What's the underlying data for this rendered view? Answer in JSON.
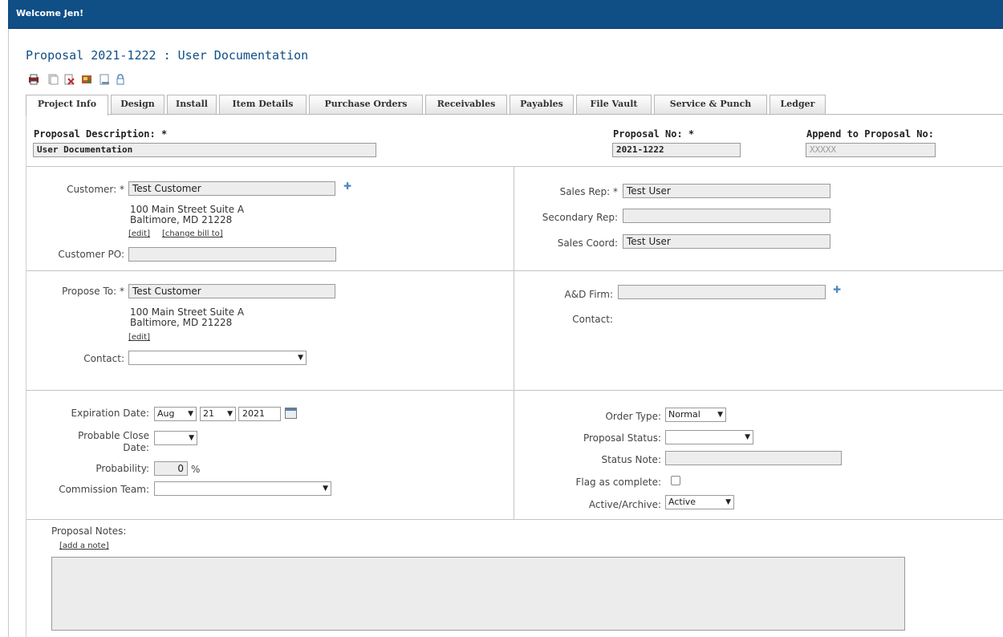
{
  "header": {
    "welcome": "Welcome Jen!"
  },
  "page": {
    "title": "Proposal 2021-1222 : User Documentation"
  },
  "toolbar": {
    "icons": [
      "print-icon",
      "copy-icon",
      "delete-icon",
      "tools-icon",
      "document-icon",
      "lock-icon"
    ]
  },
  "tabs": [
    {
      "label": "Project Info",
      "active": true
    },
    {
      "label": "Design"
    },
    {
      "label": "Install"
    },
    {
      "label": "Item Details"
    },
    {
      "label": "Purchase Orders"
    },
    {
      "label": "Receivables"
    },
    {
      "label": "Payables"
    },
    {
      "label": "File Vault"
    },
    {
      "label": "Service & Punch"
    },
    {
      "label": "Ledger"
    }
  ],
  "top": {
    "description_label": "Proposal Description: *",
    "description_value": "User Documentation",
    "number_label": "Proposal No: *",
    "number_value": "2021-1222",
    "append_label": "Append to Proposal No:",
    "append_placeholder": "XXXXX"
  },
  "customer": {
    "label": "Customer: *",
    "value": "Test Customer",
    "address_line1": "100 Main Street Suite A",
    "address_line2": "Baltimore,  MD 21228",
    "edit_link": "[edit]",
    "change_bill_link": "[change bill to]",
    "po_label": "Customer PO:",
    "po_value": ""
  },
  "reps": {
    "sales_rep_label": "Sales Rep: *",
    "sales_rep_value": "Test User",
    "secondary_rep_label": "Secondary Rep:",
    "secondary_rep_value": "",
    "sales_coord_label": "Sales Coord:",
    "sales_coord_value": "Test User"
  },
  "propose": {
    "label": "Propose To: *",
    "value": "Test Customer",
    "address_line1": "100 Main Street Suite A",
    "address_line2": "Baltimore,  MD 21228",
    "edit_link": "[edit]",
    "contact_label": "Contact:",
    "contact_value": ""
  },
  "ad": {
    "firm_label": "A&D Firm:",
    "firm_value": "",
    "contact_label": "Contact:"
  },
  "dates": {
    "expiration_label": "Expiration Date:",
    "exp_month": "Aug",
    "exp_day": "21",
    "exp_year": "2021",
    "close_label_1": "Probable Close",
    "close_label_2": "Date:",
    "close_value": "",
    "probability_label": "Probability:",
    "probability_value": "0",
    "probability_unit": "%",
    "commission_label": "Commission Team:",
    "commission_value": ""
  },
  "status": {
    "order_type_label": "Order Type:",
    "order_type_value": "Normal",
    "proposal_status_label": "Proposal Status:",
    "proposal_status_value": "",
    "status_note_label": "Status Note:",
    "status_note_value": "",
    "flag_label": "Flag as complete:",
    "active_label": "Active/Archive:",
    "active_value": "Active"
  },
  "notes": {
    "label": "Proposal Notes:",
    "add_link": "[add a note]"
  }
}
